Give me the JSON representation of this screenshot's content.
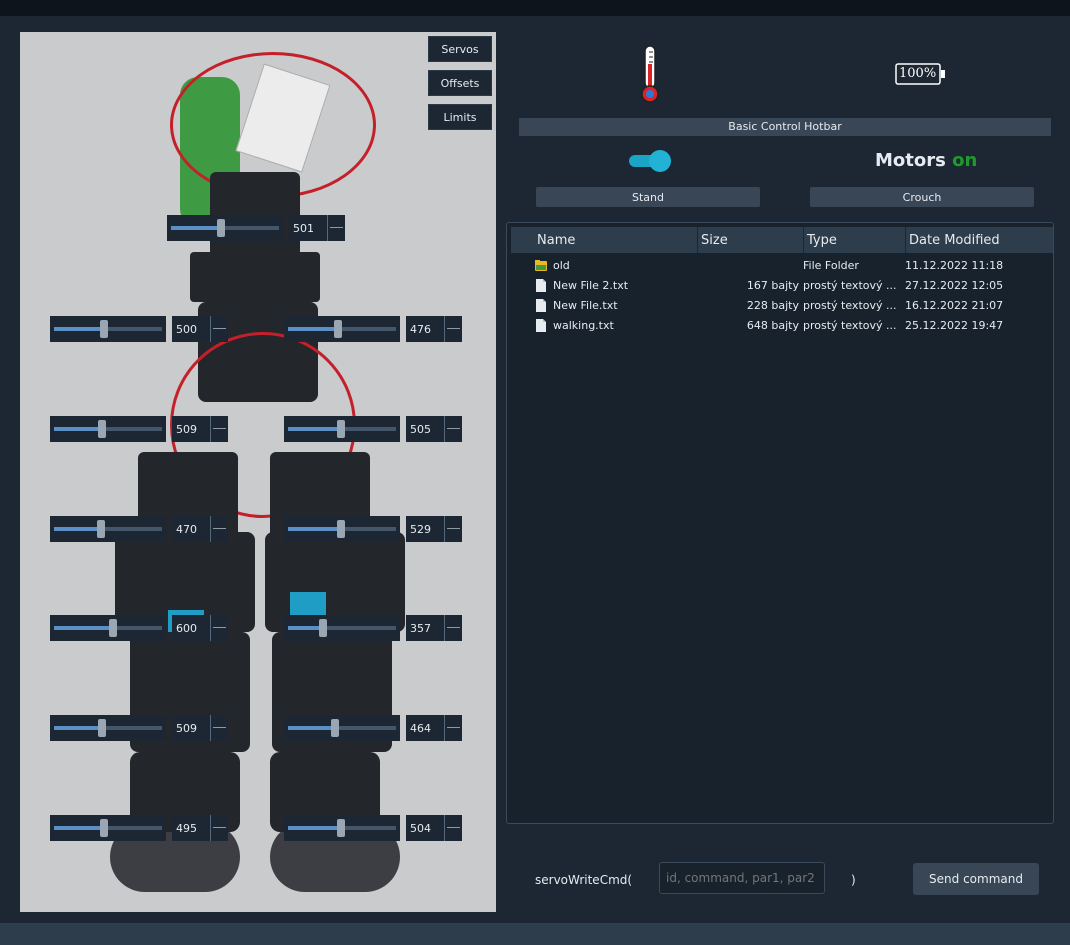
{
  "side_tabs": [
    "Servos",
    "Offsets",
    "Limits"
  ],
  "servos": [
    {
      "value": "501",
      "level": 0.5
    },
    {
      "value": "500",
      "level": 0.5
    },
    {
      "value": "476",
      "level": 0.5
    },
    {
      "value": "509",
      "level": 0.48
    },
    {
      "value": "505",
      "level": 0.53
    },
    {
      "value": "470",
      "level": 0.47
    },
    {
      "value": "529",
      "level": 0.53
    },
    {
      "value": "600",
      "level": 0.59
    },
    {
      "value": "357",
      "level": 0.35
    },
    {
      "value": "509",
      "level": 0.48
    },
    {
      "value": "464",
      "level": 0.47
    },
    {
      "value": "495",
      "level": 0.5
    },
    {
      "value": "504",
      "level": 0.53
    }
  ],
  "status": {
    "battery": "100%",
    "motors_label": "Motors",
    "motors_state": "on",
    "motors_switch_on": true
  },
  "hotbar": {
    "title": "Basic Control Hotbar",
    "stand_label": "Stand",
    "crouch_label": "Crouch"
  },
  "file_browser": {
    "columns": [
      "Name",
      "Size",
      "Type",
      "Date Modified"
    ],
    "rows": [
      {
        "icon": "folder-icon",
        "name": "old",
        "size": "",
        "type": "File Folder",
        "date": "11.12.2022 11:18"
      },
      {
        "icon": "file-icon",
        "name": "New File 2.txt",
        "size": "167 bajty",
        "type": "prostý textový ...",
        "date": "27.12.2022 12:05"
      },
      {
        "icon": "file-icon",
        "name": "New File.txt",
        "size": "228 bajty",
        "type": "prostý textový ...",
        "date": "16.12.2022 21:07"
      },
      {
        "icon": "file-icon",
        "name": "walking.txt",
        "size": "648 bajty",
        "type": "prostý textový ...",
        "date": "25.12.2022 19:47"
      }
    ]
  },
  "command": {
    "prefix": "servoWriteCmd(",
    "placeholder": "id, command, par1, par2",
    "suffix": ")",
    "send_label": "Send command"
  },
  "colors": {
    "background": "#1c2733",
    "panel": "#384655",
    "accent": "#1aa5c7",
    "motors_on": "#1e9b2a"
  }
}
